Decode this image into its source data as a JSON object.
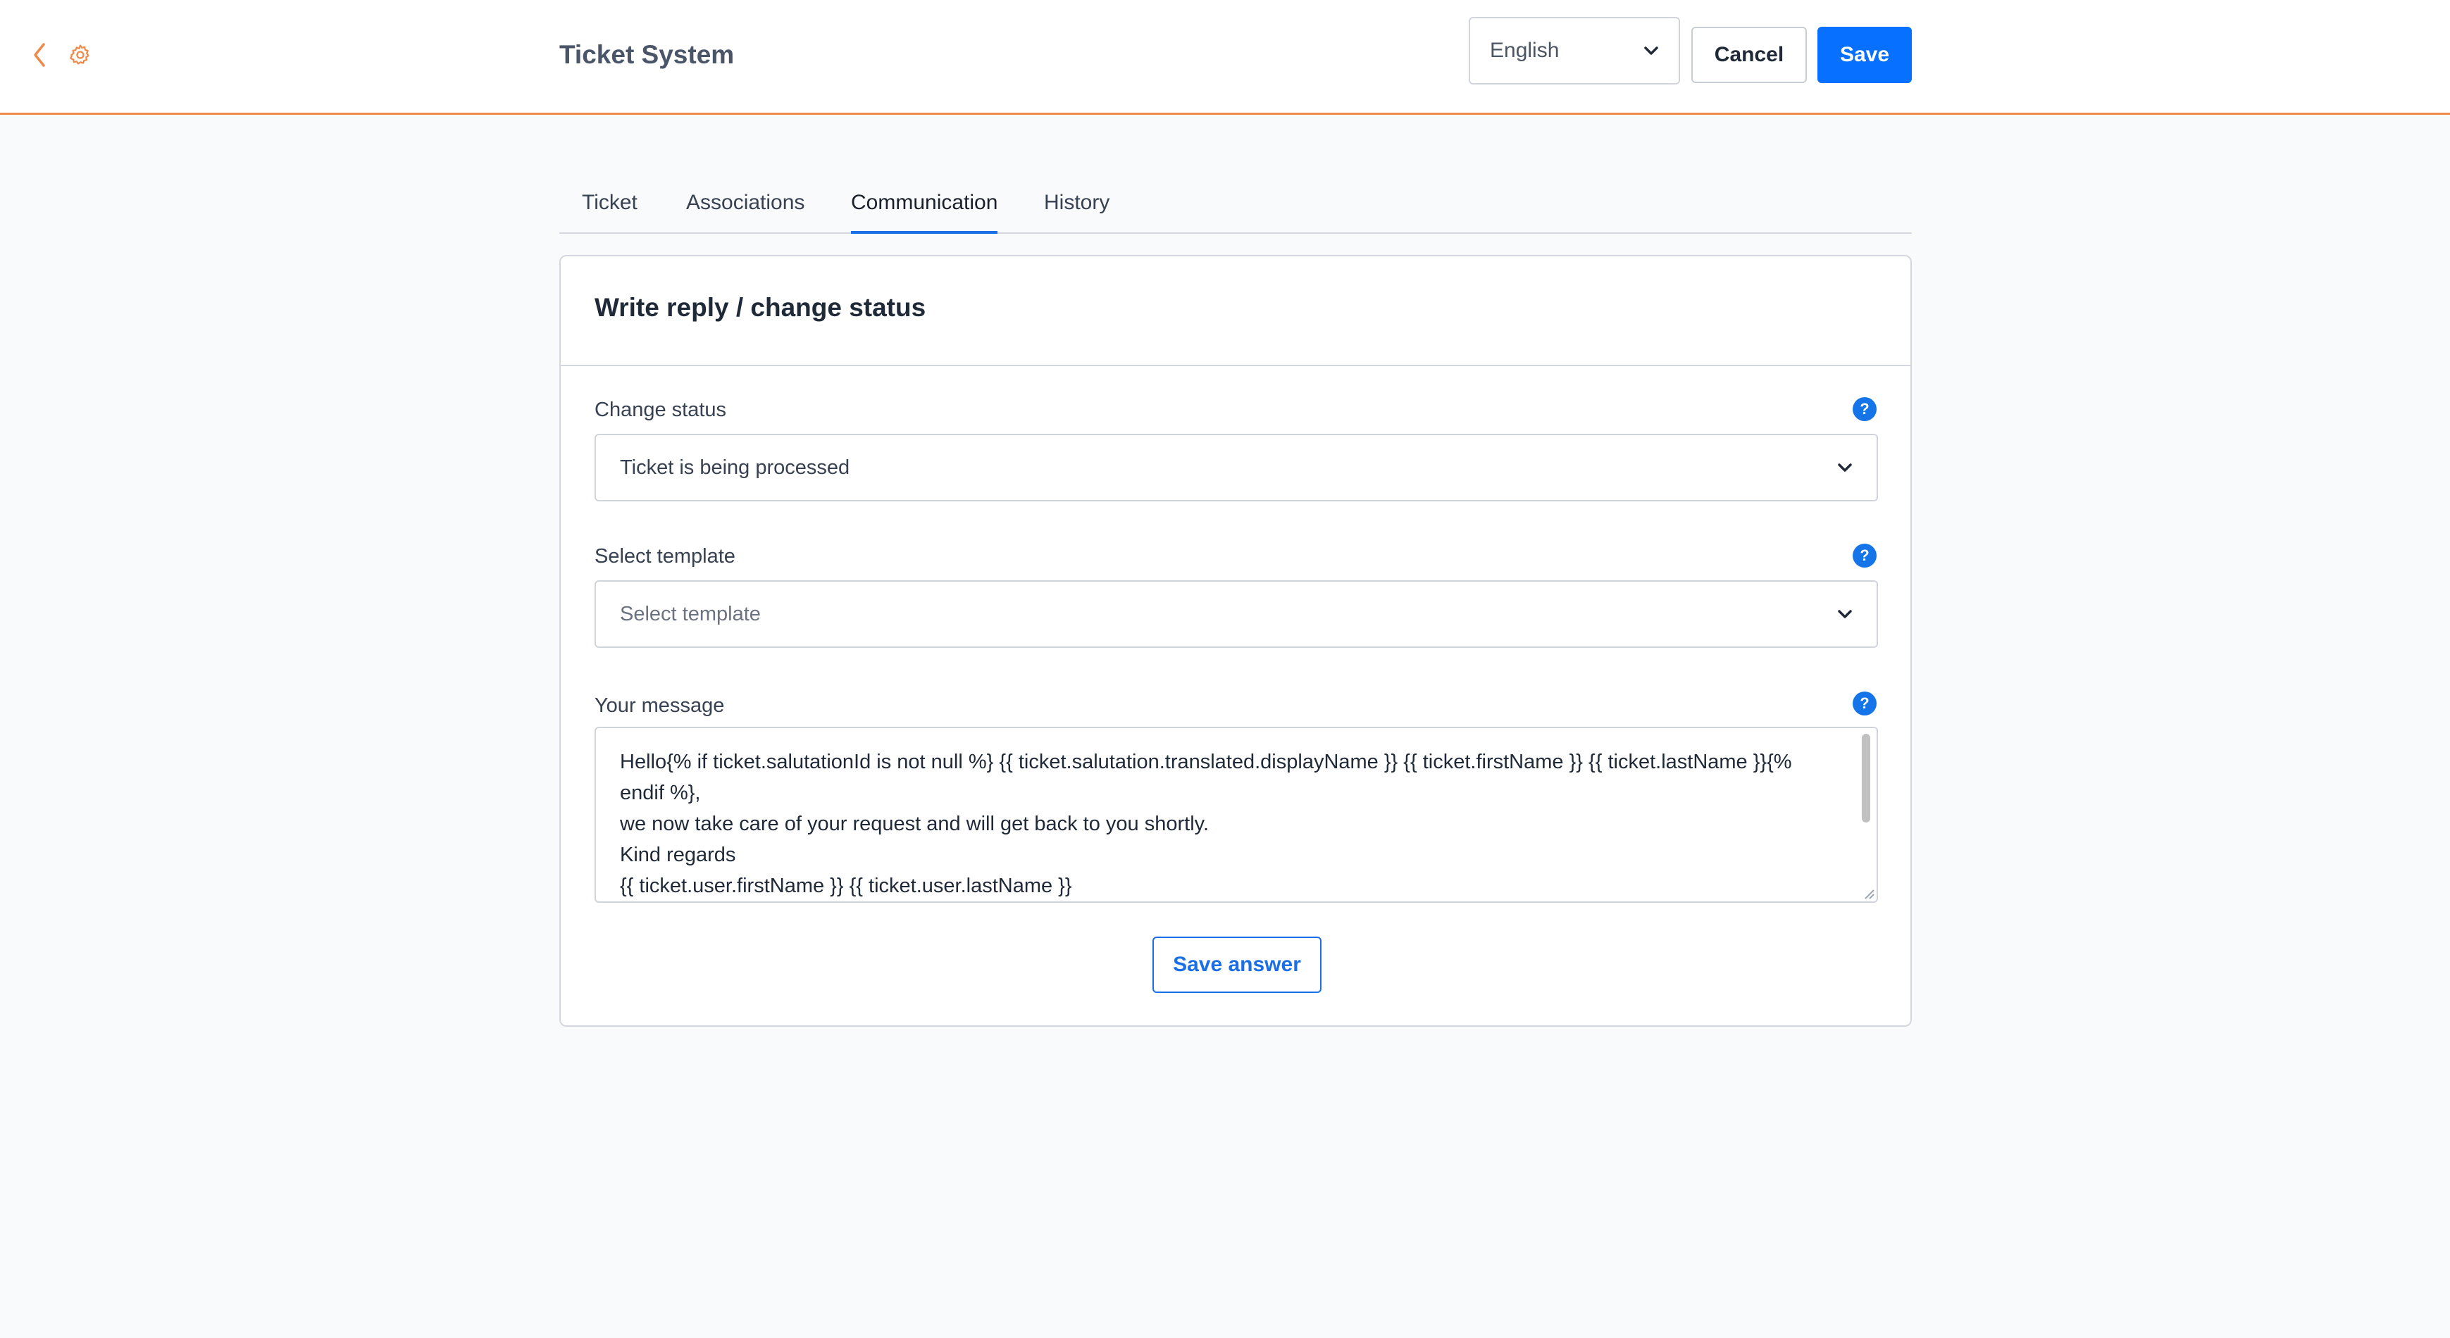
{
  "header": {
    "back_icon": "chevron-left-icon",
    "settings_icon": "gear-icon",
    "title": "Ticket System",
    "language": "English",
    "cancel_label": "Cancel",
    "save_label": "Save"
  },
  "tabs": [
    {
      "label": "Ticket",
      "active": false
    },
    {
      "label": "Associations",
      "active": false
    },
    {
      "label": "Communication",
      "active": true
    },
    {
      "label": "History",
      "active": false
    }
  ],
  "card": {
    "title": "Write reply / change status",
    "status": {
      "label": "Change status",
      "value": "Ticket is being processed"
    },
    "template": {
      "label": "Select template",
      "placeholder": "Select template"
    },
    "message": {
      "label": "Your message",
      "lines": [
        "Hello{% if ticket.salutationId is not null %} {{ ticket.salutation.translated.displayName }} {{ ticket.firstName }} {{ ticket.lastName }}{%",
        "endif %},",
        "we now take care of your request and will get back to you shortly.",
        "Kind regards",
        "{{ ticket.user.firstName }} {{ ticket.user.lastName }}"
      ]
    },
    "save_answer_label": "Save answer"
  },
  "colors": {
    "accent": "#ed8a4c",
    "primary": "#0870ff",
    "help": "#1474e8"
  }
}
